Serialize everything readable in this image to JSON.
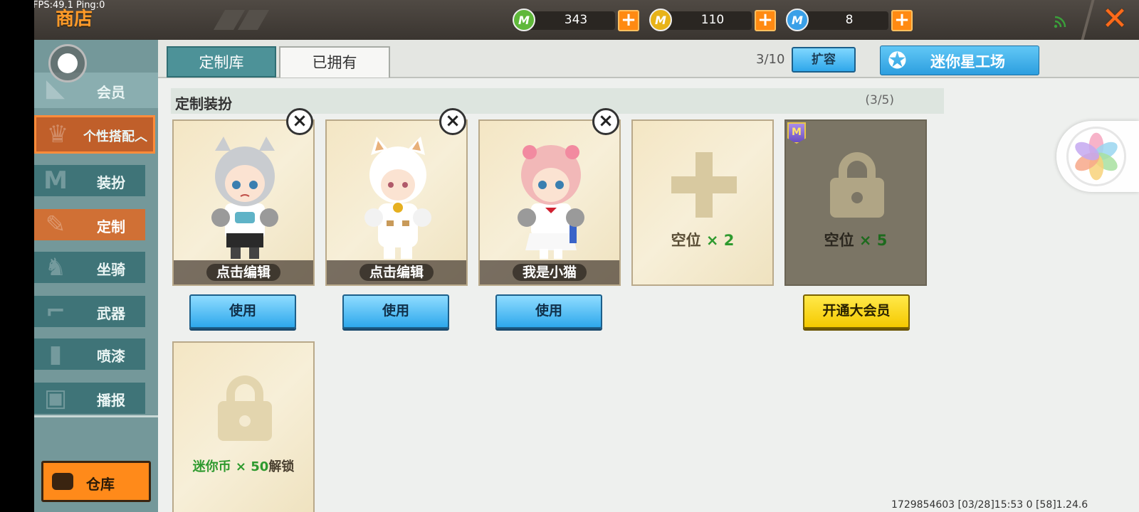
{
  "debug": {
    "fps_ping": "FPS:49.1  Ping:0"
  },
  "header": {
    "title": "商店",
    "currencies": [
      {
        "icon": "green-mini-bean-icon",
        "value": "343",
        "color": "#5fb83a"
      },
      {
        "icon": "gold-mini-coin-icon",
        "value": "110",
        "color": "#e8b318"
      },
      {
        "icon": "mini-point-icon",
        "value": "8",
        "color": "#3aa0e8"
      }
    ],
    "close_icon": "close-icon"
  },
  "sidebar": {
    "member": "会员",
    "personal_outfit": "个性搭配︿",
    "items": [
      {
        "label": "装扮",
        "icon": "shirt-icon",
        "active": false
      },
      {
        "label": "定制",
        "icon": "pencil-icon",
        "active": true
      },
      {
        "label": "坐骑",
        "icon": "mount-icon",
        "active": false
      },
      {
        "label": "武器",
        "icon": "gun-icon",
        "active": false
      },
      {
        "label": "喷漆",
        "icon": "spray-can-icon",
        "active": false
      },
      {
        "label": "播报",
        "icon": "broadcast-icon",
        "active": false
      }
    ],
    "warehouse": "仓库"
  },
  "tabs": {
    "library": "定制库",
    "owned": "已拥有"
  },
  "toolbar": {
    "slot_count": "3/10",
    "expand": "扩容",
    "mini_star_workshop": "迷你星工场"
  },
  "section": {
    "title": "定制装扮",
    "count": "(3/5)"
  },
  "cards": [
    {
      "name": "点击编辑",
      "use": "使用",
      "character": "silver-hair-wolf-girl"
    },
    {
      "name": "点击编辑",
      "use": "使用",
      "character": "white-cat-costume"
    },
    {
      "name": "我是小猫",
      "use": "使用",
      "character": "pink-hair-sailor-girl"
    }
  ],
  "empty_slot": {
    "label": "空位",
    "mult": "× 2"
  },
  "locked_vip_slot": {
    "label": "空位",
    "mult": "× 5",
    "badge": "M",
    "button": "开通大会员"
  },
  "coin_unlock_slot": {
    "prefix": "迷你币 × 50",
    "suffix": "解锁"
  },
  "footer": {
    "info": "1729854603   [03/28]15:53 0   [58]1.24.6"
  }
}
